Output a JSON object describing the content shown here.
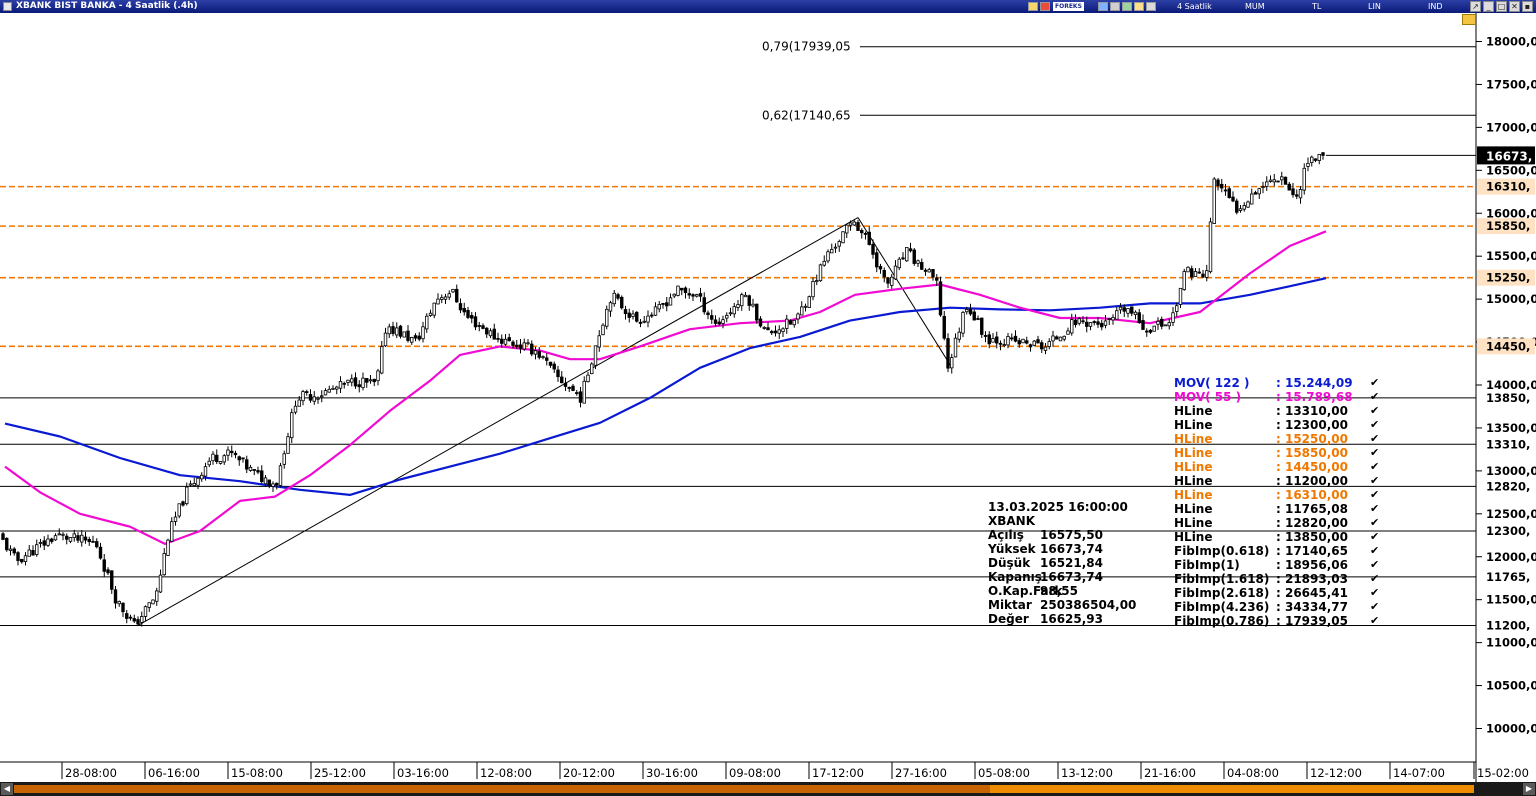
{
  "window": {
    "title": "XBANK BIST BANKA - 4 Saatlik (.4h)",
    "period": "4 Saatlik",
    "candle_mode": "MUM",
    "currency": "TL",
    "scale_mode": "LIN",
    "ind_label": "IND",
    "brand": "FOREKS"
  },
  "colors": {
    "up_candle": "#ffffff",
    "down_candle": "#000000",
    "mov122": "#0a1ad2",
    "mov55": "#f00ad2",
    "hline_orange": "#f07800",
    "hline_black": "#000000",
    "price_box": "#000000",
    "orange_box": "#ffe2c4"
  },
  "chart_data": {
    "type": "candlestick",
    "symbol": "XBANK",
    "ylim": [
      9700,
      18450
    ],
    "x_tick_labels": [
      "28-08:00",
      "06-16:00",
      "15-08:00",
      "25-12:00",
      "03-16:00",
      "12-08:00",
      "20-12:00",
      "30-16:00",
      "09-08:00",
      "17-12:00",
      "27-16:00",
      "05-08:00",
      "13-12:00",
      "21-16:00",
      "04-08:00",
      "12-12:00",
      "14-07:00",
      "15-02:00"
    ],
    "y_tick_values": [
      10000,
      10500,
      11000,
      11500,
      12000,
      12500,
      13000,
      13500,
      14000,
      14500,
      15000,
      15500,
      16000,
      16500,
      17000,
      17500,
      18000
    ],
    "y_tick_labels": [
      "10000,0",
      "10500,0",
      "11000,0",
      "11500,0",
      "12000,0",
      "12500,0",
      "13000,0",
      "13500,0",
      "14000,0",
      "14500,0",
      "15000,0",
      "15500,0",
      "16000,0",
      "16500,0",
      "17000,0",
      "17500,0",
      "18000,0"
    ],
    "last_price": 16673.74,
    "last_price_label": "16673,",
    "price_path_key_points": [
      [
        0,
        12300
      ],
      [
        20,
        11950
      ],
      [
        60,
        12250
      ],
      [
        100,
        12150
      ],
      [
        120,
        11500
      ],
      [
        138,
        11200
      ],
      [
        160,
        11550
      ],
      [
        172,
        12250
      ],
      [
        190,
        12750
      ],
      [
        215,
        13150
      ],
      [
        235,
        13200
      ],
      [
        260,
        12950
      ],
      [
        280,
        12850
      ],
      [
        300,
        13850
      ],
      [
        325,
        13900
      ],
      [
        360,
        14050
      ],
      [
        380,
        14000
      ],
      [
        390,
        14700
      ],
      [
        420,
        14500
      ],
      [
        440,
        15000
      ],
      [
        455,
        15100
      ],
      [
        470,
        14800
      ],
      [
        500,
        14550
      ],
      [
        540,
        14400
      ],
      [
        560,
        14100
      ],
      [
        585,
        13850
      ],
      [
        600,
        14500
      ],
      [
        615,
        15050
      ],
      [
        640,
        14750
      ],
      [
        660,
        14850
      ],
      [
        680,
        15100
      ],
      [
        700,
        15050
      ],
      [
        720,
        14700
      ],
      [
        750,
        15050
      ],
      [
        770,
        14600
      ],
      [
        800,
        14750
      ],
      [
        830,
        15500
      ],
      [
        858,
        15920
      ],
      [
        875,
        15600
      ],
      [
        890,
        15150
      ],
      [
        910,
        15550
      ],
      [
        940,
        15200
      ],
      [
        952,
        14200
      ],
      [
        970,
        14950
      ],
      [
        990,
        14550
      ],
      [
        1020,
        14500
      ],
      [
        1050,
        14450
      ],
      [
        1080,
        14750
      ],
      [
        1110,
        14700
      ],
      [
        1130,
        14900
      ],
      [
        1150,
        14650
      ],
      [
        1175,
        14750
      ],
      [
        1190,
        15350
      ],
      [
        1210,
        15250
      ],
      [
        1218,
        16400
      ],
      [
        1240,
        16050
      ],
      [
        1262,
        16300
      ],
      [
        1285,
        16450
      ],
      [
        1300,
        16150
      ],
      [
        1310,
        16600
      ],
      [
        1328,
        16673.74
      ]
    ],
    "mov122_points": [
      [
        5,
        13550
      ],
      [
        60,
        13400
      ],
      [
        120,
        13150
      ],
      [
        180,
        12950
      ],
      [
        240,
        12880
      ],
      [
        300,
        12780
      ],
      [
        350,
        12720
      ],
      [
        400,
        12900
      ],
      [
        450,
        13050
      ],
      [
        500,
        13200
      ],
      [
        550,
        13380
      ],
      [
        600,
        13560
      ],
      [
        650,
        13850
      ],
      [
        700,
        14200
      ],
      [
        750,
        14430
      ],
      [
        800,
        14560
      ],
      [
        850,
        14750
      ],
      [
        900,
        14850
      ],
      [
        950,
        14900
      ],
      [
        1000,
        14880
      ],
      [
        1050,
        14870
      ],
      [
        1100,
        14900
      ],
      [
        1150,
        14950
      ],
      [
        1200,
        14950
      ],
      [
        1250,
        15050
      ],
      [
        1290,
        15150
      ],
      [
        1326,
        15244.09
      ]
    ],
    "mov55_points": [
      [
        5,
        13050
      ],
      [
        40,
        12750
      ],
      [
        80,
        12500
      ],
      [
        130,
        12350
      ],
      [
        165,
        12150
      ],
      [
        200,
        12300
      ],
      [
        240,
        12650
      ],
      [
        275,
        12700
      ],
      [
        310,
        12950
      ],
      [
        350,
        13300
      ],
      [
        390,
        13700
      ],
      [
        430,
        14050
      ],
      [
        460,
        14350
      ],
      [
        500,
        14450
      ],
      [
        540,
        14400
      ],
      [
        570,
        14300
      ],
      [
        600,
        14300
      ],
      [
        640,
        14450
      ],
      [
        690,
        14650
      ],
      [
        740,
        14720
      ],
      [
        790,
        14750
      ],
      [
        820,
        14850
      ],
      [
        855,
        15050
      ],
      [
        900,
        15120
      ],
      [
        940,
        15170
      ],
      [
        980,
        15050
      ],
      [
        1020,
        14900
      ],
      [
        1060,
        14780
      ],
      [
        1100,
        14780
      ],
      [
        1150,
        14720
      ],
      [
        1200,
        14850
      ],
      [
        1250,
        15300
      ],
      [
        1290,
        15620
      ],
      [
        1326,
        15789.68
      ]
    ],
    "horizontal_lines": [
      {
        "value": 13310,
        "color": "#000000",
        "style": "solid",
        "label": "13310,"
      },
      {
        "value": 12300,
        "color": "#000000",
        "style": "solid",
        "label": "12300,"
      },
      {
        "value": 15250,
        "color": "#f07800",
        "style": "dashed",
        "label": "15250,"
      },
      {
        "value": 15850,
        "color": "#f07800",
        "style": "dashed",
        "label": "15850,"
      },
      {
        "value": 14450,
        "color": "#f07800",
        "style": "dashed",
        "label": "14450,"
      },
      {
        "value": 11200,
        "color": "#000000",
        "style": "solid",
        "label": "11200,"
      },
      {
        "value": 16310,
        "color": "#f07800",
        "style": "dashed",
        "label": "16310,"
      },
      {
        "value": 11765,
        "color": "#000000",
        "style": "solid",
        "label": "11765,"
      },
      {
        "value": 12820,
        "color": "#000000",
        "style": "solid",
        "label": "12820,"
      },
      {
        "value": 13850,
        "color": "#000000",
        "style": "solid",
        "label": "13850,"
      }
    ],
    "fib_lines": [
      {
        "value": 17939.05,
        "label": "0,79(17939,05"
      },
      {
        "value": 17140.65,
        "label": "0,62(17140,65"
      }
    ],
    "trend_lines": [
      {
        "from": [
          138,
          11200
        ],
        "to": [
          858,
          15950
        ]
      },
      {
        "from": [
          858,
          15950
        ],
        "to": [
          952,
          14200
        ]
      }
    ],
    "ohlc_info": {
      "datetime": "13.03.2025  16:00:00",
      "symbol": "XBANK",
      "rows": [
        {
          "label": "Açılış",
          "value": "16575,50"
        },
        {
          "label": "Yüksek",
          "value": "16673,74"
        },
        {
          "label": "Düşük",
          "value": "16521,84"
        },
        {
          "label": "Kapanış",
          "value": "16673,74"
        },
        {
          "label": "O.Kap.Fark",
          "value": "98,55"
        },
        {
          "label": "Miktar",
          "value": "250386504,00"
        },
        {
          "label": "Değer",
          "value": "16625,93"
        }
      ]
    },
    "legend": [
      {
        "name": "MOV( 122 )",
        "value": ": 15.244,09",
        "color": "#0a1ad2"
      },
      {
        "name": "MOV( 55 )",
        "value": ": 15.789,68",
        "color": "#f00ad2"
      },
      {
        "name": "HLine",
        "value": ": 13310,00",
        "color": "#000000"
      },
      {
        "name": "HLine",
        "value": ": 12300,00",
        "color": "#000000"
      },
      {
        "name": "HLine",
        "value": ": 15250,00",
        "color": "#f07800"
      },
      {
        "name": "HLine",
        "value": ": 15850,00",
        "color": "#f07800"
      },
      {
        "name": "HLine",
        "value": ": 14450,00",
        "color": "#f07800"
      },
      {
        "name": "HLine",
        "value": ": 11200,00",
        "color": "#000000"
      },
      {
        "name": "HLine",
        "value": ": 16310,00",
        "color": "#f07800"
      },
      {
        "name": "HLine",
        "value": ": 11765,08",
        "color": "#000000"
      },
      {
        "name": "HLine",
        "value": ": 12820,00",
        "color": "#000000"
      },
      {
        "name": "HLine",
        "value": ": 13850,00",
        "color": "#000000"
      },
      {
        "name": "FibImp(0.618)",
        "value": ": 17140,65",
        "color": "#000000"
      },
      {
        "name": "FibImp(1)",
        "value": ": 18956,06",
        "color": "#000000"
      },
      {
        "name": "FibImp(1.618)",
        "value": ": 21893,03",
        "color": "#000000"
      },
      {
        "name": "FibImp(2.618)",
        "value": ": 26645,41",
        "color": "#000000"
      },
      {
        "name": "FibImp(4.236)",
        "value": ": 34334,77",
        "color": "#000000"
      },
      {
        "name": "FibImp(0.786)",
        "value": ": 17939,05",
        "color": "#000000"
      }
    ]
  }
}
